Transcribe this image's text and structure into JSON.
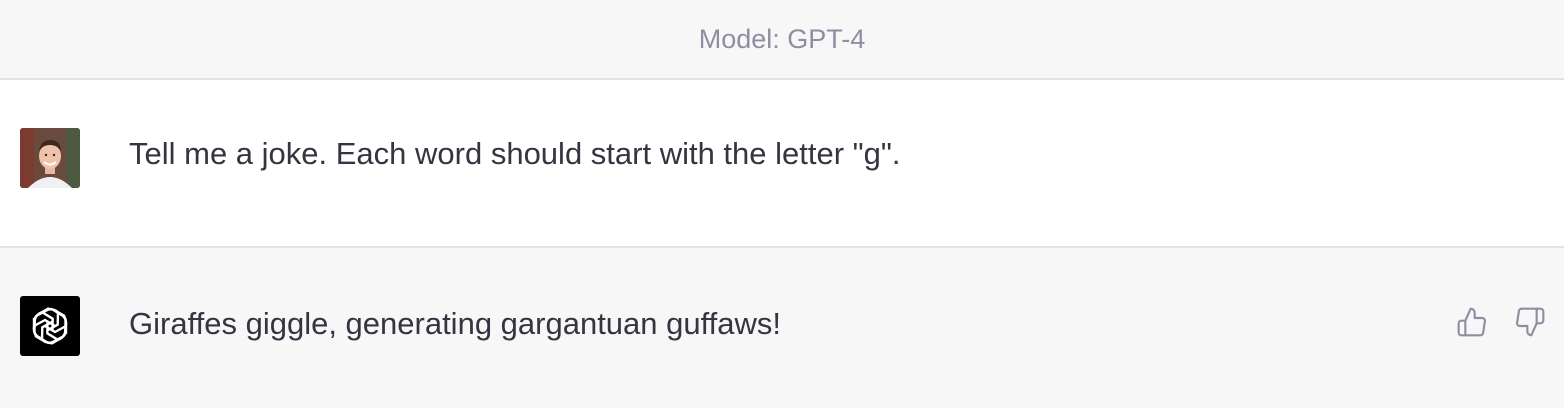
{
  "header": {
    "model_label": "Model: GPT-4"
  },
  "conversation": {
    "user_message": {
      "avatar_icon": "user-photo-avatar",
      "text": "Tell me a joke. Each word should start with the letter \"g\"."
    },
    "assistant_message": {
      "avatar_icon": "openai-logo-icon",
      "text": "Giraffes giggle, generating gargantuan guffaws!",
      "feedback_icons": [
        "thumbs-up-icon",
        "thumbs-down-icon"
      ]
    }
  },
  "colors": {
    "header_bg": "#f7f7f8",
    "user_bg": "#ffffff",
    "assistant_bg": "#f7f7f8",
    "text": "#343541",
    "muted": "#8e8ea0"
  }
}
